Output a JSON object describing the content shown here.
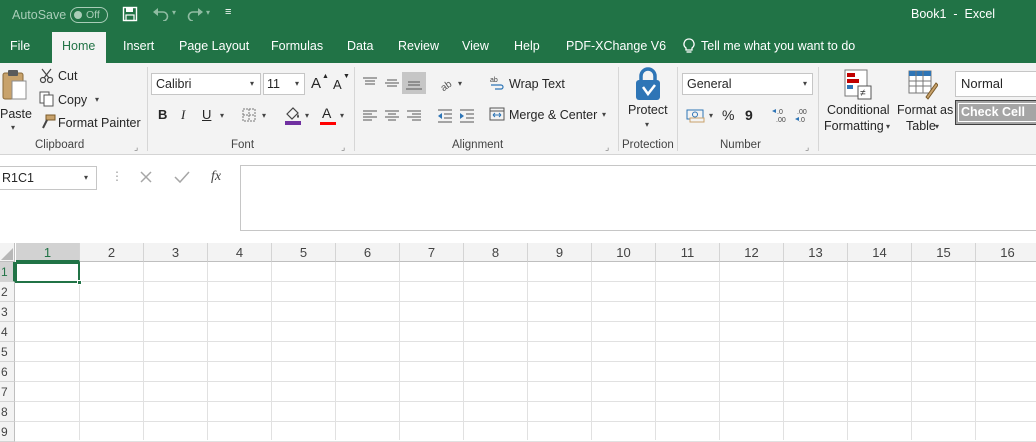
{
  "titlebar": {
    "autosave_label": "AutoSave",
    "autosave_state": "Off",
    "title": "Book1  -  Excel"
  },
  "tabs": [
    {
      "label": "File"
    },
    {
      "label": "Home"
    },
    {
      "label": "Insert"
    },
    {
      "label": "Page Layout"
    },
    {
      "label": "Formulas"
    },
    {
      "label": "Data"
    },
    {
      "label": "Review"
    },
    {
      "label": "View"
    },
    {
      "label": "Help"
    },
    {
      "label": "PDF-XChange V6"
    }
  ],
  "tell_me": "Tell me what you want to do",
  "clipboard": {
    "paste": "Paste",
    "cut": "Cut",
    "copy": "Copy",
    "format_painter": "Format Painter",
    "group": "Clipboard"
  },
  "font": {
    "name": "Calibri",
    "size": "11",
    "bold": "B",
    "italic": "I",
    "underline": "U",
    "grow": "A",
    "shrink": "A",
    "font_color": "A",
    "group": "Font"
  },
  "alignment": {
    "wrap_text": "Wrap Text",
    "merge_center": "Merge & Center",
    "group": "Alignment"
  },
  "protection": {
    "protect": "Protect",
    "group": "Protection"
  },
  "number": {
    "format": "General",
    "percent": "%",
    "comma": "9",
    "inc_decimal": "←.0\n.00",
    "group": "Number"
  },
  "styles": {
    "conditional_formatting_1": "Conditional",
    "conditional_formatting_2": "Formatting",
    "format_as_table_1": "Format as",
    "format_as_table_2": "Table",
    "normal": "Normal",
    "check_cell": "Check Cell"
  },
  "formula_bar": {
    "name_box": "R1C1",
    "fx": "fx",
    "content": ""
  },
  "columns": [
    "1",
    "2",
    "3",
    "4",
    "5",
    "6",
    "7",
    "8",
    "9",
    "10",
    "11",
    "12",
    "13",
    "14",
    "15",
    "16"
  ],
  "rows": [
    "1",
    "2",
    "3",
    "4",
    "5",
    "6",
    "7",
    "8",
    "9"
  ],
  "colors": {
    "excel_green": "#217346",
    "ribbon_bg": "#f3f3f3",
    "protect_blue": "#2e75b6"
  }
}
